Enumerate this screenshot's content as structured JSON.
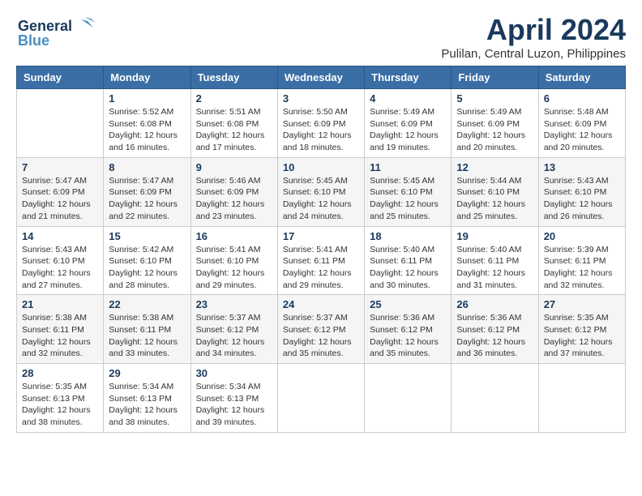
{
  "logo": {
    "line1": "General",
    "line2": "Blue",
    "bird": "🔵"
  },
  "title": "April 2024",
  "location": "Pulilan, Central Luzon, Philippines",
  "days_of_week": [
    "Sunday",
    "Monday",
    "Tuesday",
    "Wednesday",
    "Thursday",
    "Friday",
    "Saturday"
  ],
  "weeks": [
    [
      {
        "day": "",
        "info": ""
      },
      {
        "day": "1",
        "info": "Sunrise: 5:52 AM\nSunset: 6:08 PM\nDaylight: 12 hours\nand 16 minutes."
      },
      {
        "day": "2",
        "info": "Sunrise: 5:51 AM\nSunset: 6:08 PM\nDaylight: 12 hours\nand 17 minutes."
      },
      {
        "day": "3",
        "info": "Sunrise: 5:50 AM\nSunset: 6:09 PM\nDaylight: 12 hours\nand 18 minutes."
      },
      {
        "day": "4",
        "info": "Sunrise: 5:49 AM\nSunset: 6:09 PM\nDaylight: 12 hours\nand 19 minutes."
      },
      {
        "day": "5",
        "info": "Sunrise: 5:49 AM\nSunset: 6:09 PM\nDaylight: 12 hours\nand 20 minutes."
      },
      {
        "day": "6",
        "info": "Sunrise: 5:48 AM\nSunset: 6:09 PM\nDaylight: 12 hours\nand 20 minutes."
      }
    ],
    [
      {
        "day": "7",
        "info": "Sunrise: 5:47 AM\nSunset: 6:09 PM\nDaylight: 12 hours\nand 21 minutes."
      },
      {
        "day": "8",
        "info": "Sunrise: 5:47 AM\nSunset: 6:09 PM\nDaylight: 12 hours\nand 22 minutes."
      },
      {
        "day": "9",
        "info": "Sunrise: 5:46 AM\nSunset: 6:09 PM\nDaylight: 12 hours\nand 23 minutes."
      },
      {
        "day": "10",
        "info": "Sunrise: 5:45 AM\nSunset: 6:10 PM\nDaylight: 12 hours\nand 24 minutes."
      },
      {
        "day": "11",
        "info": "Sunrise: 5:45 AM\nSunset: 6:10 PM\nDaylight: 12 hours\nand 25 minutes."
      },
      {
        "day": "12",
        "info": "Sunrise: 5:44 AM\nSunset: 6:10 PM\nDaylight: 12 hours\nand 25 minutes."
      },
      {
        "day": "13",
        "info": "Sunrise: 5:43 AM\nSunset: 6:10 PM\nDaylight: 12 hours\nand 26 minutes."
      }
    ],
    [
      {
        "day": "14",
        "info": "Sunrise: 5:43 AM\nSunset: 6:10 PM\nDaylight: 12 hours\nand 27 minutes."
      },
      {
        "day": "15",
        "info": "Sunrise: 5:42 AM\nSunset: 6:10 PM\nDaylight: 12 hours\nand 28 minutes."
      },
      {
        "day": "16",
        "info": "Sunrise: 5:41 AM\nSunset: 6:10 PM\nDaylight: 12 hours\nand 29 minutes."
      },
      {
        "day": "17",
        "info": "Sunrise: 5:41 AM\nSunset: 6:11 PM\nDaylight: 12 hours\nand 29 minutes."
      },
      {
        "day": "18",
        "info": "Sunrise: 5:40 AM\nSunset: 6:11 PM\nDaylight: 12 hours\nand 30 minutes."
      },
      {
        "day": "19",
        "info": "Sunrise: 5:40 AM\nSunset: 6:11 PM\nDaylight: 12 hours\nand 31 minutes."
      },
      {
        "day": "20",
        "info": "Sunrise: 5:39 AM\nSunset: 6:11 PM\nDaylight: 12 hours\nand 32 minutes."
      }
    ],
    [
      {
        "day": "21",
        "info": "Sunrise: 5:38 AM\nSunset: 6:11 PM\nDaylight: 12 hours\nand 32 minutes."
      },
      {
        "day": "22",
        "info": "Sunrise: 5:38 AM\nSunset: 6:11 PM\nDaylight: 12 hours\nand 33 minutes."
      },
      {
        "day": "23",
        "info": "Sunrise: 5:37 AM\nSunset: 6:12 PM\nDaylight: 12 hours\nand 34 minutes."
      },
      {
        "day": "24",
        "info": "Sunrise: 5:37 AM\nSunset: 6:12 PM\nDaylight: 12 hours\nand 35 minutes."
      },
      {
        "day": "25",
        "info": "Sunrise: 5:36 AM\nSunset: 6:12 PM\nDaylight: 12 hours\nand 35 minutes."
      },
      {
        "day": "26",
        "info": "Sunrise: 5:36 AM\nSunset: 6:12 PM\nDaylight: 12 hours\nand 36 minutes."
      },
      {
        "day": "27",
        "info": "Sunrise: 5:35 AM\nSunset: 6:12 PM\nDaylight: 12 hours\nand 37 minutes."
      }
    ],
    [
      {
        "day": "28",
        "info": "Sunrise: 5:35 AM\nSunset: 6:13 PM\nDaylight: 12 hours\nand 38 minutes."
      },
      {
        "day": "29",
        "info": "Sunrise: 5:34 AM\nSunset: 6:13 PM\nDaylight: 12 hours\nand 38 minutes."
      },
      {
        "day": "30",
        "info": "Sunrise: 5:34 AM\nSunset: 6:13 PM\nDaylight: 12 hours\nand 39 minutes."
      },
      {
        "day": "",
        "info": ""
      },
      {
        "day": "",
        "info": ""
      },
      {
        "day": "",
        "info": ""
      },
      {
        "day": "",
        "info": ""
      }
    ]
  ]
}
